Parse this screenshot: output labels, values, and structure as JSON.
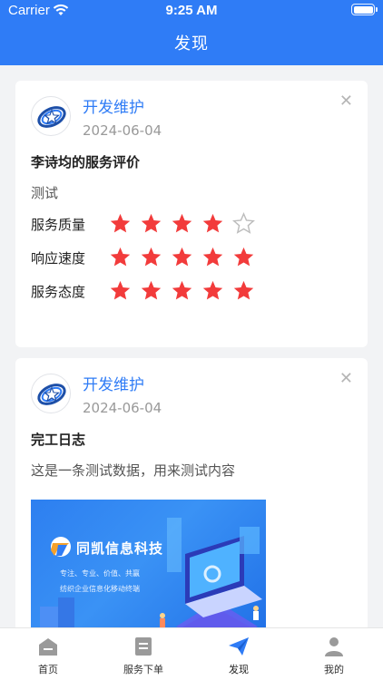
{
  "status_bar": {
    "carrier": "Carrier",
    "time": "9:25 AM"
  },
  "header": {
    "title": "发现"
  },
  "feed": [
    {
      "author": "开发维护",
      "date": "2024-06-04",
      "title": "李诗均的服务评价",
      "content": "测试",
      "ratings": [
        {
          "label": "服务质量",
          "score": 4,
          "max": 5
        },
        {
          "label": "响应速度",
          "score": 5,
          "max": 5
        },
        {
          "label": "服务态度",
          "score": 5,
          "max": 5
        }
      ]
    },
    {
      "author": "开发维护",
      "date": "2024-06-04",
      "title": "完工日志",
      "content": "这是一条测试数据，用来测试内容",
      "image": {
        "brand": "同凯信息科技",
        "slogan": "专注、专业、价值、共赢",
        "tagline": "纺织企业信息化移动终端"
      }
    }
  ],
  "tabbar": {
    "items": [
      {
        "label": "首页",
        "icon": "home-icon"
      },
      {
        "label": "服务下单",
        "icon": "order-icon"
      },
      {
        "label": "发现",
        "icon": "discover-icon",
        "active": true
      },
      {
        "label": "我的",
        "icon": "user-icon"
      }
    ]
  },
  "colors": {
    "primary": "#2f7cf6",
    "star": "#f23b3b",
    "star_empty": "#bdbdbd"
  }
}
